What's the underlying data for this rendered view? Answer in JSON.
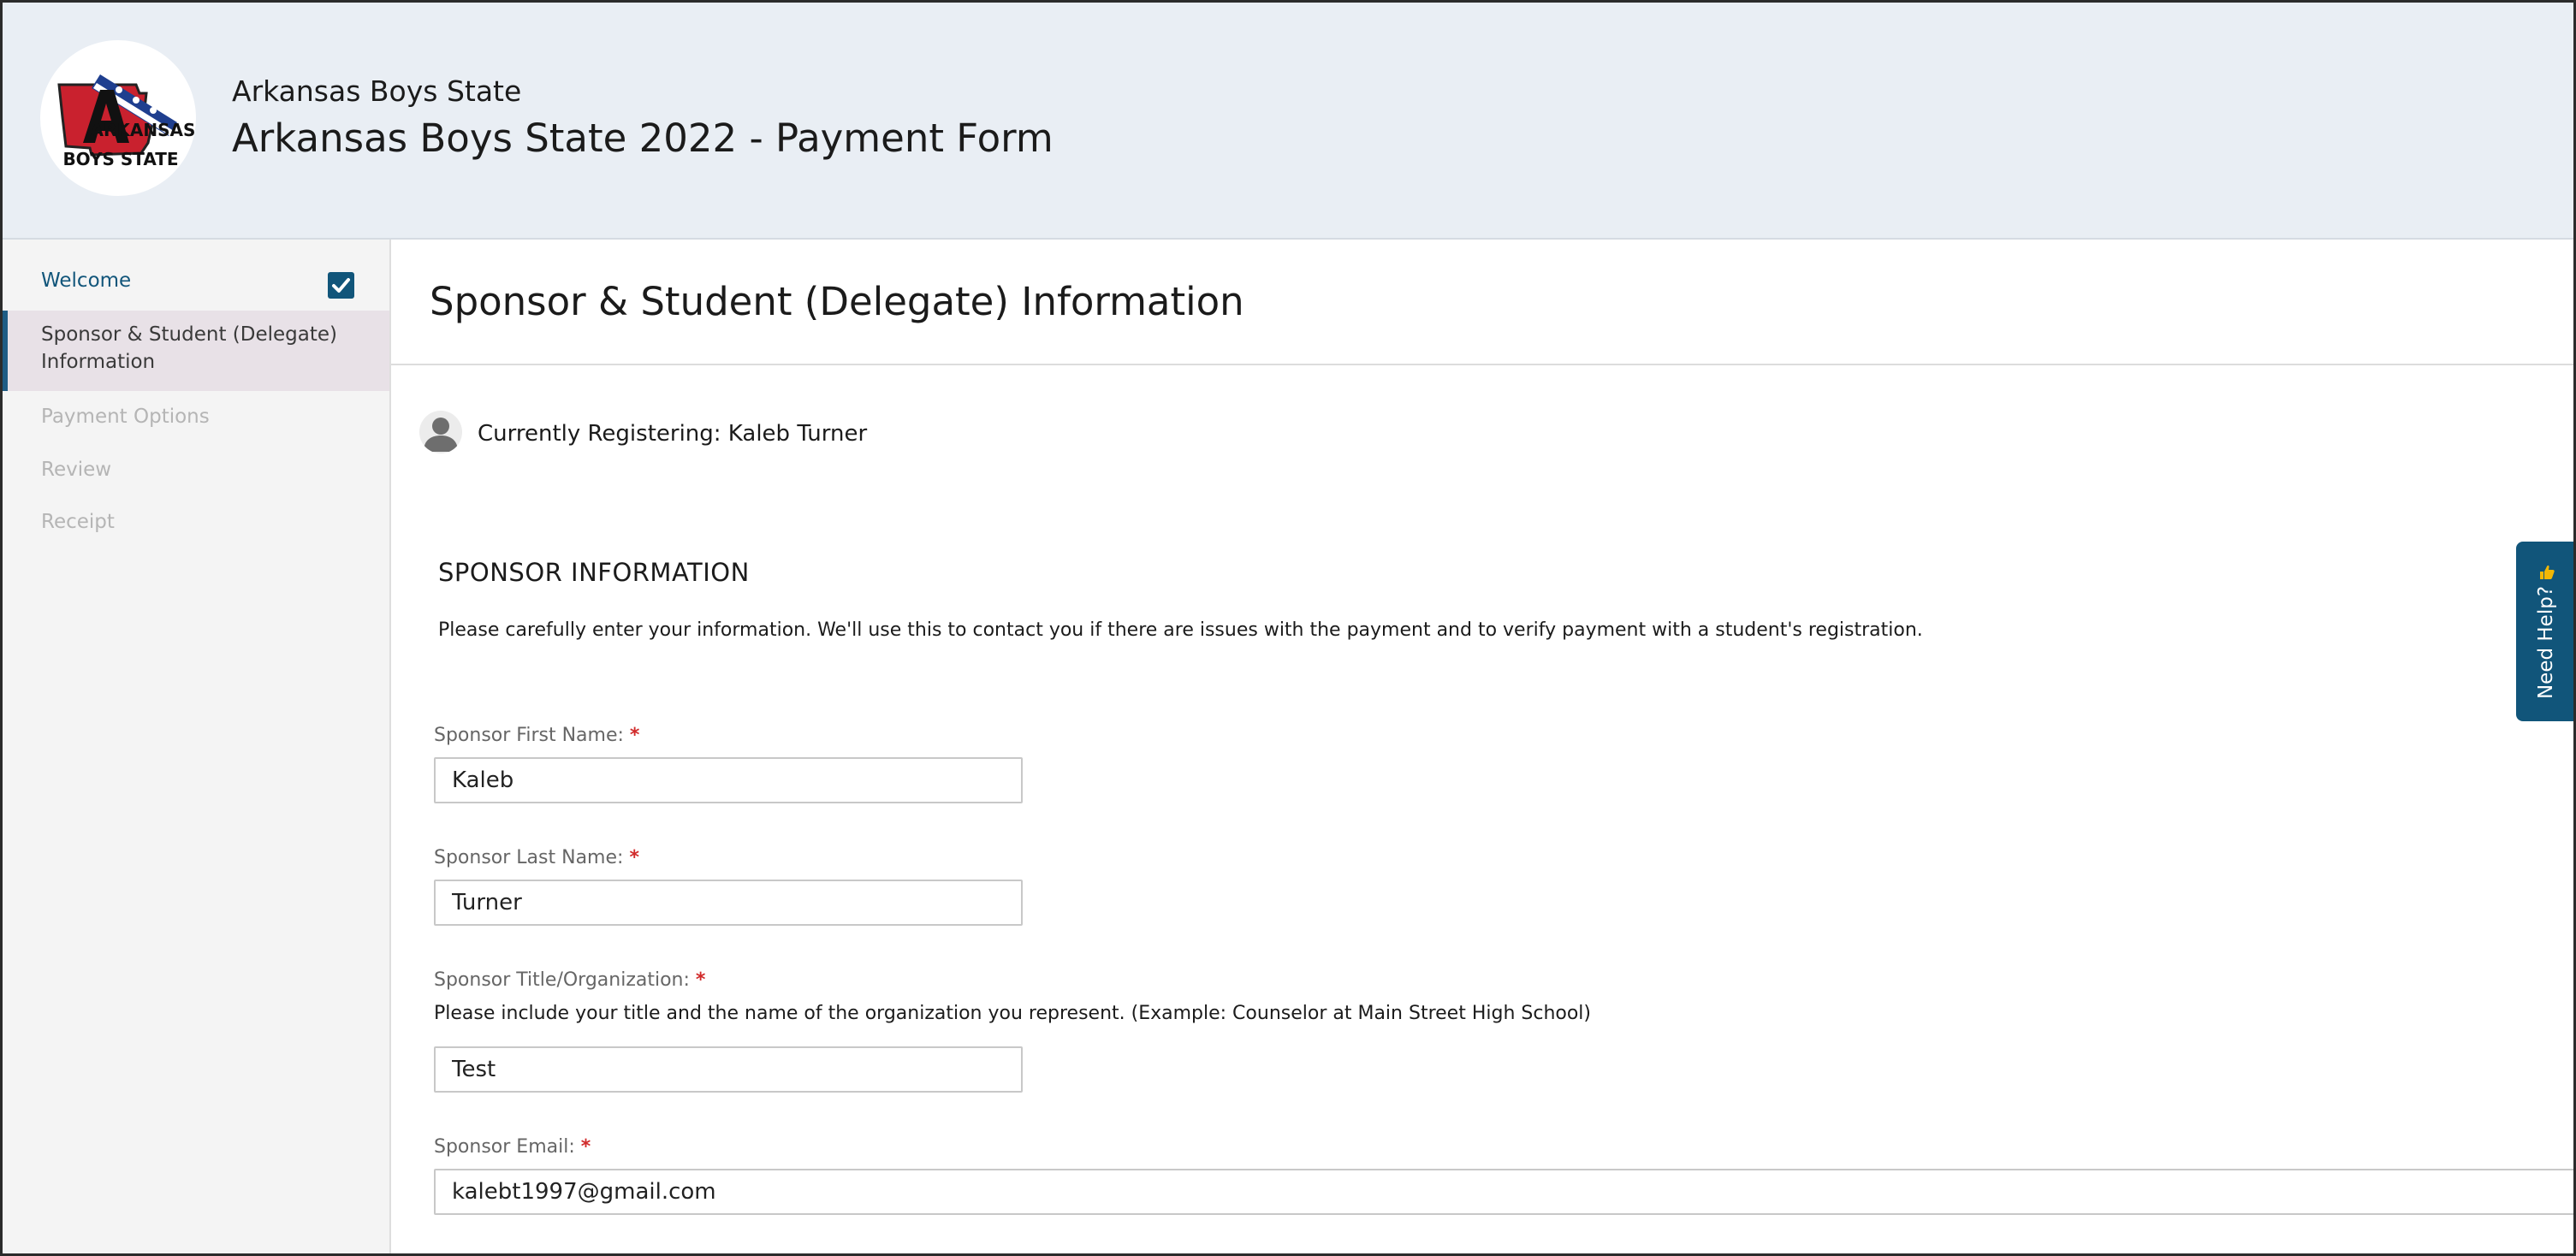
{
  "header": {
    "org_name": "Arkansas Boys State",
    "form_title": "Arkansas Boys State 2022 - Payment Form",
    "logo_line1": "ARKANSAS",
    "logo_line2": "BOYS STATE"
  },
  "sidebar": {
    "items": [
      {
        "label": "Welcome",
        "state": "completed"
      },
      {
        "label": "Sponsor & Student (Delegate) Information",
        "state": "active"
      },
      {
        "label": "Payment Options",
        "state": "disabled"
      },
      {
        "label": "Review",
        "state": "disabled"
      },
      {
        "label": "Receipt",
        "state": "disabled"
      }
    ]
  },
  "main": {
    "page_heading": "Sponsor & Student (Delegate) Information",
    "registering": "Currently Registering: Kaleb Turner",
    "section": {
      "heading": "SPONSOR INFORMATION",
      "description": "Please carefully enter your information. We'll use this to contact you if there are issues with the payment and to verify payment with a student's registration."
    },
    "fields": {
      "first_name": {
        "label": "Sponsor First Name:",
        "value": "Kaleb"
      },
      "last_name": {
        "label": "Sponsor Last Name:",
        "value": "Turner"
      },
      "title_org": {
        "label": "Sponsor Title/Organization:",
        "help": "Please include your title and the name of the organization you represent. (Example: Counselor at Main Street High School)",
        "value": "Test"
      },
      "email": {
        "label": "Sponsor Email:",
        "value": "kalebt1997@gmail.com"
      }
    },
    "required_marker": "*"
  },
  "need_help": {
    "label": "Need Help?"
  },
  "colors": {
    "accent": "#11557a",
    "header_bg": "#e9eef4",
    "required": "#d12b2b",
    "sidebar_active_bg": "#e8e1e7"
  }
}
